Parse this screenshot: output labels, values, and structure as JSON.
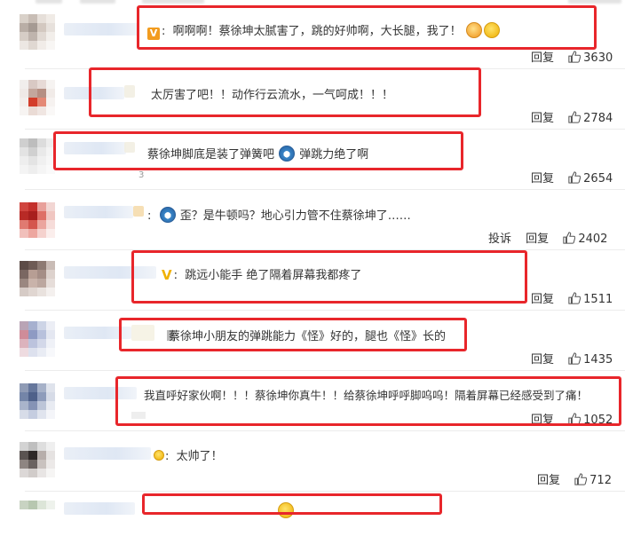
{
  "comments": [
    {
      "text": "啊啊啊！蔡徐坤太腻害了，跳的好帅啊，大长腿，我了！",
      "reply": "回复",
      "likes": "3630"
    },
    {
      "text": "太厉害了吧！！动作行云流水，一气呵成！！！",
      "reply": "回复",
      "likes": "2784"
    },
    {
      "text_a": "蔡徐坤脚底是装了弹簧吧",
      "text_b": "弹跳力绝了啊",
      "reply": "回复",
      "likes": "2654",
      "mark": "3"
    },
    {
      "text_a": "歪？是牛顿吗？地心引力管不住蔡徐坤了……",
      "report": "投诉",
      "reply": "回复",
      "likes": "2402"
    },
    {
      "text": "跳远小能手 绝了隔着屏幕我都疼了",
      "reply": "回复",
      "likes": "1511"
    },
    {
      "text": "蔡徐坤小朋友的弹跳能力《怪》好的，腿也《怪》长的",
      "reply": "回复",
      "likes": "1435"
    },
    {
      "text": "我直呼好家伙啊！！！蔡徐坤你真牛！！给蔡徐坤呼呼脚呜呜！隔着屏幕已经感受到了痛！",
      "reply": "回复",
      "likes": "1052"
    },
    {
      "text": "太帅了！",
      "reply": "回复",
      "likes": "712"
    }
  ],
  "colors": {
    "highlight": "#e8262b",
    "link": "#333333",
    "badge": "#f29c1f"
  },
  "icons": {
    "like": "thumbs-up-icon",
    "verified": "v-badge-icon"
  }
}
